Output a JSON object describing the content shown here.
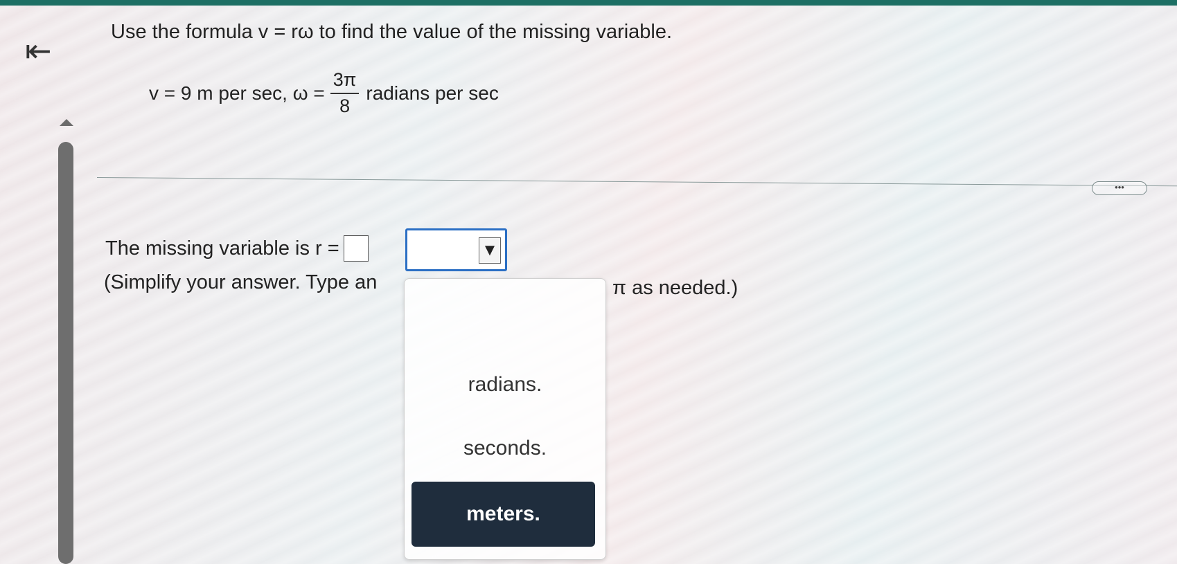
{
  "nav": {
    "back_icon": "⇤"
  },
  "problem": {
    "instruction": "Use the formula v = rω to find the value of the missing variable.",
    "given_v": "v = 9 m per sec, ω =",
    "fraction_numerator": "3π",
    "fraction_denominator": "8",
    "given_units": "radians per sec"
  },
  "toolbar": {
    "more_label": "•••"
  },
  "answer": {
    "prompt": "The missing variable is r =",
    "input_value": "",
    "unit_selected": "",
    "select_arrow": "▼",
    "hint_left": "(Simplify your answer. Type an",
    "hint_right": "π as needed.)"
  },
  "dropdown": {
    "options": [
      "radians.",
      "seconds.",
      "meters."
    ],
    "highlighted_index": 2
  },
  "colors": {
    "topbar": "#1d6f64",
    "select_border": "#2b6fc4",
    "highlight": "#1f2d3d"
  }
}
